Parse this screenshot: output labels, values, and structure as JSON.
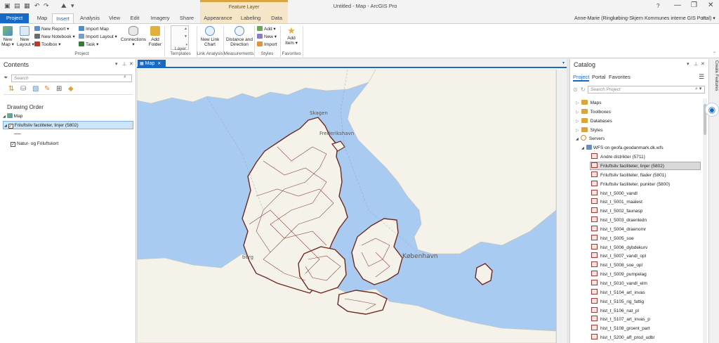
{
  "titlebar": {
    "app_title": "Untitled - Map - ArcGIS Pro",
    "contextual_group": "Feature Layer",
    "help": "?",
    "minimize": "—",
    "restore": "❐",
    "close": "✕"
  },
  "tabs": {
    "project": "Project",
    "map": "Map",
    "insert": "Insert",
    "analysis": "Analysis",
    "view": "View",
    "edit": "Edit",
    "imagery": "Imagery",
    "share": "Share",
    "appearance": "Appearance",
    "labeling": "Labeling",
    "data": "Data"
  },
  "user": {
    "label": "Anne-Marie (Ringkøbing-Skjern Kommunes interne GIS Portal) ▾",
    "bell": "🔔"
  },
  "ribbon": {
    "new_map": "New\nMap ▾",
    "new_layout": "New\nLayout ▾",
    "new_report": "New Report ▾",
    "new_notebook": "New Notebook ▾",
    "toolbox": "Toolbox ▾",
    "import_map": "Import Map",
    "import_layout": "Import Layout ▾",
    "task": "Task ▾",
    "connections": "Connections\n▾",
    "add_folder": "Add\nFolder",
    "group_project": "Project",
    "group_layer_templates": "Layer Templates",
    "new_link_chart": "New Link\nChart",
    "group_link_analysis": "Link Analysis",
    "distance_direction": "Distance and\nDirection",
    "group_measurements": "Measurements",
    "styles_add": "Add ▾",
    "styles_new": "New ▾",
    "styles_import": "Import",
    "group_styles": "Styles",
    "add_item": "Add\nItem ▾",
    "group_favorites": "Favorites"
  },
  "contents": {
    "title": "Contents",
    "search_placeholder": "Search",
    "drawing_order": "Drawing Order",
    "map_node": "Map",
    "layer1": "Friluftsliv faciliteter,  linjer (5802)",
    "layer2": "Natur- og Friluftskort"
  },
  "map_tab": {
    "label": "Map",
    "close": "✕"
  },
  "map_labels": {
    "skagen": "Skagen",
    "frederikshavn": "Frederikshavn",
    "kobenhavn": "København",
    "bergen_partial": "berg"
  },
  "catalog": {
    "title": "Catalog",
    "tab_project": "Project",
    "tab_portal": "Portal",
    "tab_favorites": "Favorites",
    "search_placeholder": "Search Project",
    "items": [
      {
        "label": "Maps",
        "type": "folder",
        "level": 0
      },
      {
        "label": "Toolboxes",
        "type": "folder",
        "level": 0
      },
      {
        "label": "Databases",
        "type": "folder",
        "level": 0
      },
      {
        "label": "Styles",
        "type": "folder",
        "level": 0
      },
      {
        "label": "Servers",
        "type": "server",
        "level": 0
      },
      {
        "label": "WFS on geofa.geodanmark.dk.wfs",
        "type": "wfs",
        "level": 1
      },
      {
        "label": "Andre distrikter (5711)",
        "type": "layer",
        "level": 2
      },
      {
        "label": "Friluftsliv faciliteter,  linjer (5802)",
        "type": "layer",
        "level": 2,
        "selected": true
      },
      {
        "label": "Friluftsliv faciliteter, flader (5801)",
        "type": "layer",
        "level": 2
      },
      {
        "label": "Friluftsliv faciliteter, punkter (5800)",
        "type": "layer",
        "level": 2
      },
      {
        "label": "hist_t_5000_vandl",
        "type": "layer",
        "level": 2
      },
      {
        "label": "hist_t_5001_maalest",
        "type": "layer",
        "level": 2
      },
      {
        "label": "hist_t_5002_faunasp",
        "type": "layer",
        "level": 2
      },
      {
        "label": "hist_t_5003_draenledn",
        "type": "layer",
        "level": 2
      },
      {
        "label": "hist_t_5004_draenomr",
        "type": "layer",
        "level": 2
      },
      {
        "label": "hist_t_5005_soe",
        "type": "layer",
        "level": 2
      },
      {
        "label": "hist_t_5006_dybdekurv",
        "type": "layer",
        "level": 2
      },
      {
        "label": "hist_t_5007_vandl_opl",
        "type": "layer",
        "level": 2
      },
      {
        "label": "hist_t_5008_soe_opl",
        "type": "layer",
        "level": 2
      },
      {
        "label": "hist_t_5009_pumpelag",
        "type": "layer",
        "level": 2
      },
      {
        "label": "hist_t_5010_vandl_elm",
        "type": "layer",
        "level": 2
      },
      {
        "label": "hist_t_5104_art_invas",
        "type": "layer",
        "level": 2
      },
      {
        "label": "hist_t_5105_rig_fattig",
        "type": "layer",
        "level": 2
      },
      {
        "label": "hist_t_5106_nat_pl",
        "type": "layer",
        "level": 2
      },
      {
        "label": "hist_t_5107_art_invas_p",
        "type": "layer",
        "level": 2
      },
      {
        "label": "hist_t_5108_groent_part",
        "type": "layer",
        "level": 2
      },
      {
        "label": "hist_t_5200_aff_prod_udbr",
        "type": "layer",
        "level": 2
      }
    ]
  },
  "side_strip": {
    "create_features": "Create Features"
  },
  "colors": {
    "accent": "#1769c3",
    "contextual": "#f6e6c8",
    "sea": "#a9cbf2",
    "land": "#f4f2e9",
    "trails": "#7a2a1f",
    "selection": "#cde4f7"
  }
}
